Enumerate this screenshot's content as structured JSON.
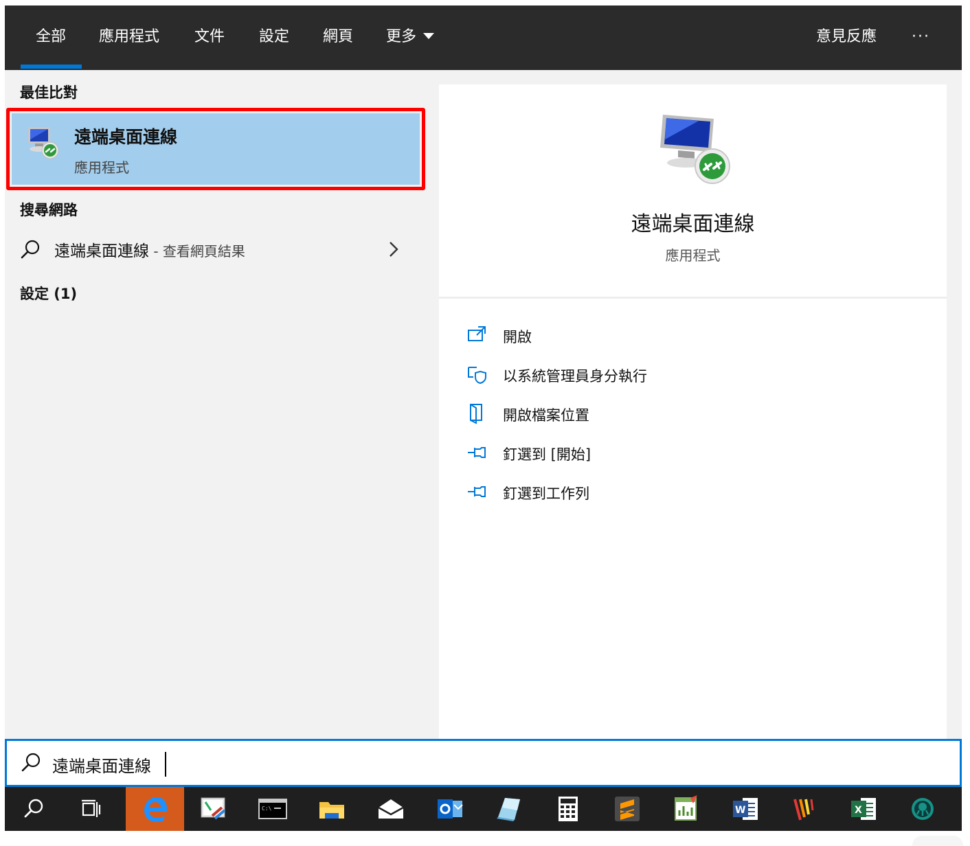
{
  "tabs": [
    {
      "id": "all",
      "label": "全部",
      "active": true
    },
    {
      "id": "apps",
      "label": "應用程式"
    },
    {
      "id": "docs",
      "label": "文件"
    },
    {
      "id": "settings",
      "label": "設定"
    },
    {
      "id": "web",
      "label": "網頁"
    },
    {
      "id": "more",
      "label": "更多"
    }
  ],
  "topbar_right": {
    "feedback": "意見反應",
    "more_options": "···"
  },
  "left": {
    "best_match_heading": "最佳比對",
    "best_match": {
      "title": "遠端桌面連線",
      "subtitle": "應用程式",
      "icon": "remote-desktop-icon"
    },
    "web_heading": "搜尋網路",
    "web_result": {
      "query": "遠端桌面連線",
      "suffix": " - 查看網頁結果"
    },
    "settings_heading": "設定 (1)"
  },
  "right": {
    "title": "遠端桌面連線",
    "subtitle": "應用程式",
    "actions": [
      {
        "label": "開啟",
        "icon": "open-icon"
      },
      {
        "label": "以系統管理員身分執行",
        "icon": "admin-shield-icon"
      },
      {
        "label": "開啟檔案位置",
        "icon": "file-location-icon"
      },
      {
        "label": "釘選到 [開始]",
        "icon": "pin-icon"
      },
      {
        "label": "釘選到工作列",
        "icon": "pin-icon"
      }
    ]
  },
  "search": {
    "value": "遠端桌面連線"
  },
  "taskbar": [
    "search-icon",
    "task-view-icon",
    "edge-icon",
    "snipping-tool-icon",
    "command-prompt-icon",
    "file-explorer-icon",
    "mail-icon",
    "outlook-icon",
    "notepad-icon",
    "calculator-icon",
    "sublime-text-icon",
    "office-tool-icon",
    "word-icon",
    "vpn-tool-icon",
    "excel-icon",
    "gitkraken-icon"
  ],
  "colors": {
    "accent": "#0078d7",
    "selection": "#a3cdec",
    "highlight_border": "#ff0000",
    "topbar": "#2b2b2b",
    "taskbar": "#1f1f1f"
  }
}
